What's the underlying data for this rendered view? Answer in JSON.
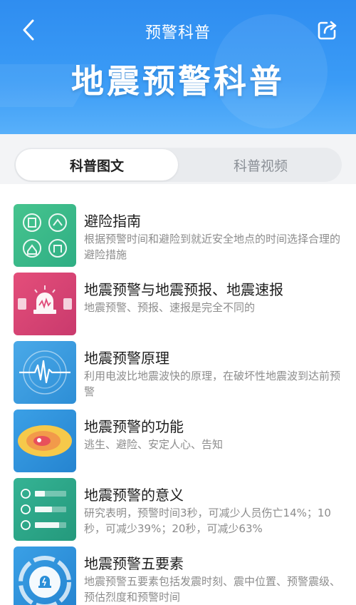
{
  "header": {
    "nav_title": "预警科普",
    "banner_title": "地震预警科普",
    "back_icon": "chevron-left-icon",
    "share_icon": "share-icon"
  },
  "tabs": [
    {
      "label": "科普图文",
      "active": true
    },
    {
      "label": "科普视频",
      "active": false
    }
  ],
  "articles": [
    {
      "title": "避险指南",
      "desc": "根据预警时间和避险到就近安全地点的时间选择合理的避险措施",
      "thumb_color": "#3dbf8c",
      "icon": "evacuation-icon"
    },
    {
      "title": "地震预警与地震预报、地震速报",
      "desc": "地震预警、预报、速报是完全不同的",
      "thumb_color": "#e04a7a",
      "icon": "alarm-siren-icon"
    },
    {
      "title": "地震预警原理",
      "desc": "利用电波比地震波快的原理，在破坏性地震波到达前预警",
      "thumb_color": "#3a9ce0",
      "icon": "seismograph-icon"
    },
    {
      "title": "地震预警的功能",
      "desc": "逃生、避险、安定人心、告知",
      "thumb_color": "#2a8fd8",
      "icon": "intensity-map-icon"
    },
    {
      "title": "地震预警的意义",
      "desc": "研究表明，预警时间3秒，可减少人员伤亡14%；10秒，可减少39%；20秒，可减少63%",
      "thumb_color": "#29a889",
      "icon": "timer-bars-icon"
    },
    {
      "title": "地震预警五要素",
      "desc": "地震预警五要素包括发震时刻、震中位置、预警震级、预估烈度和预警时间",
      "thumb_color": "#2a8fd8",
      "icon": "five-elements-icon"
    }
  ]
}
